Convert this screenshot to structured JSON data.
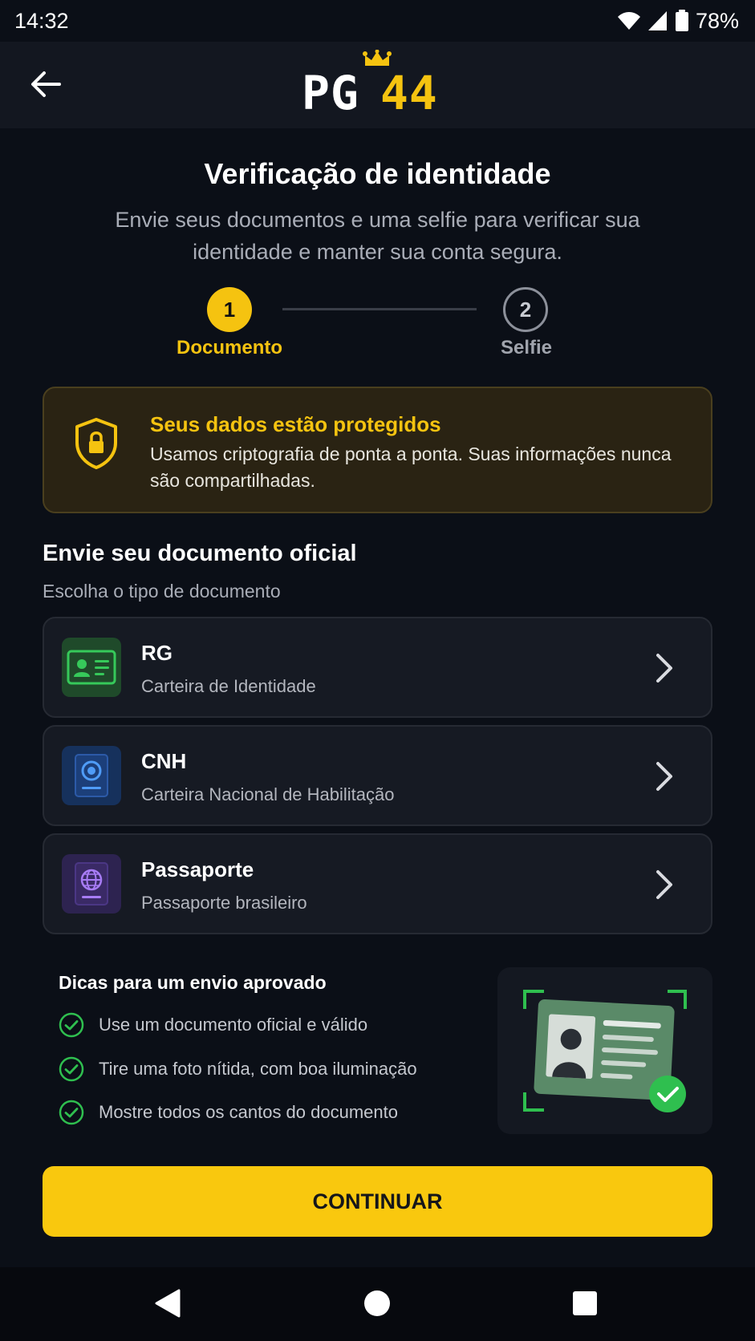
{
  "status_bar": {
    "time": "14:32",
    "battery": "78%"
  },
  "app_bar": {
    "logo_text_left": "PG",
    "logo_text_right": "44"
  },
  "header": {
    "title": "Verificação de identidade",
    "subtitle": "Envie seus documentos e uma selfie para verificar sua identidade e manter sua conta segura."
  },
  "stepper": {
    "steps": [
      {
        "number": "1",
        "label": "Documento",
        "active": true
      },
      {
        "number": "2",
        "label": "Selfie",
        "active": false
      }
    ]
  },
  "notice": {
    "title": "Seus dados estão protegidos",
    "text": "Usamos criptografia de ponta a ponta. Suas informações nunca são compartilhadas."
  },
  "section": {
    "title": "Envie seu documento oficial",
    "subtitle": "Escolha o tipo de documento"
  },
  "documents": [
    {
      "label": "RG",
      "description": "Carteira de Identidade",
      "icon": "id-card-icon",
      "color": "#2fbf4f"
    },
    {
      "label": "CNH",
      "description": "Carteira Nacional de Habilitação",
      "icon": "driver-license-icon",
      "color": "#3f8ef0"
    },
    {
      "label": "Passaporte",
      "description": "Passaporte brasileiro",
      "icon": "passport-icon",
      "color": "#9b6cf0"
    }
  ],
  "tips": {
    "title": "Dicas para um envio aprovado",
    "items": [
      "Use um documento oficial e válido",
      "Tire uma foto nítida, com boa iluminação",
      "Mostre todos os cantos do documento"
    ]
  },
  "continue_button": {
    "label": "CONTINUAR"
  },
  "colors": {
    "accent": "#f5c310",
    "success": "#2fbf4f",
    "background": "#0b0f17"
  }
}
